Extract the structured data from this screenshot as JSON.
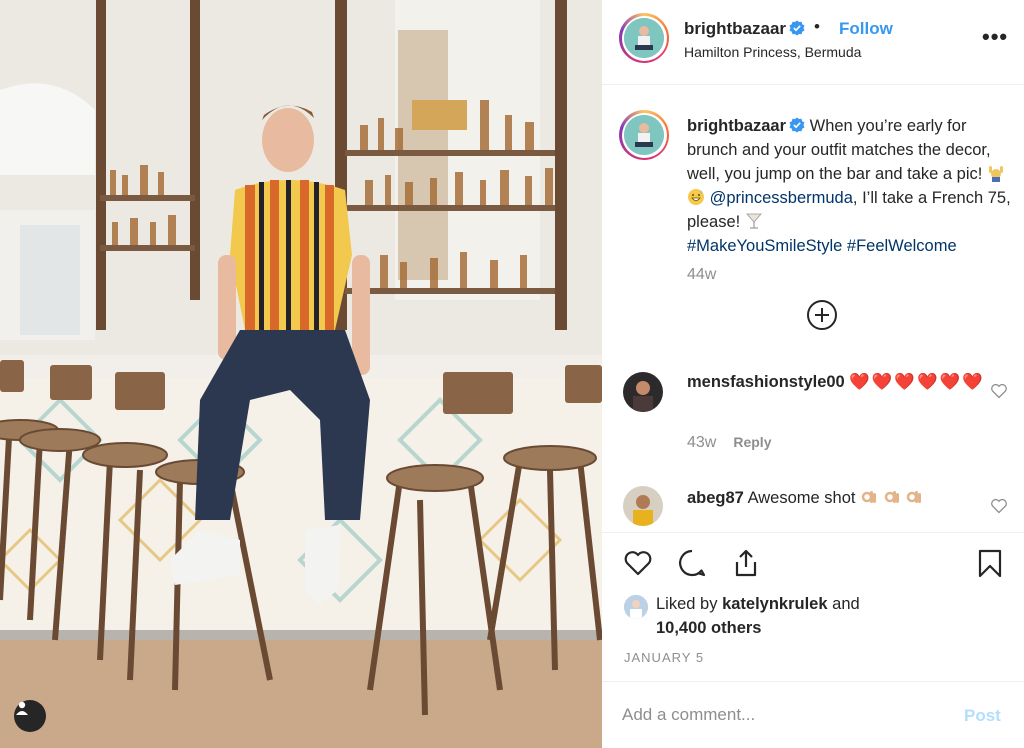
{
  "header": {
    "username": "brightbazaar",
    "separator": "•",
    "follow_label": "Follow",
    "location": "Hamilton Princess, Bermuda",
    "more_label": "•••"
  },
  "caption": {
    "username": "brightbazaar",
    "text_1": "When you’re early for brunch and your outfit matches the decor, well, you jump on the bar and take a pic!",
    "mention": "@princessbermuda",
    "text_2": ", I’ll take a French 75, please!",
    "hashtag_1": "#MakeYouSmileStyle",
    "hashtag_2": "#FeelWelcome",
    "age": "44w"
  },
  "comments": [
    {
      "username": "mensfashionstyle00",
      "hearts": "❤️❤️❤️❤️❤️❤️",
      "age": "43w",
      "reply_label": "Reply"
    },
    {
      "username": "abeg87",
      "text": "Awesome shot"
    }
  ],
  "likes": {
    "prefix": "Liked by",
    "liker": "katelynkrulek",
    "and": "and",
    "others": "10,400 others"
  },
  "date": "JANUARY 5",
  "comment_input": {
    "placeholder": "Add a comment...",
    "post_label": "Post"
  },
  "colors": {
    "link_blue": "#3897f0",
    "mention_blue": "#003569",
    "secondary_text": "#8e8e8e",
    "heart_red": "#ed4956",
    "post_disabled": "#b2dffc"
  },
  "icons": [
    "verified-badge-icon",
    "more-options-icon",
    "load-more-plus-icon",
    "heart-outline-icon",
    "comment-icon",
    "share-icon",
    "bookmark-icon",
    "user-tag-icon"
  ]
}
